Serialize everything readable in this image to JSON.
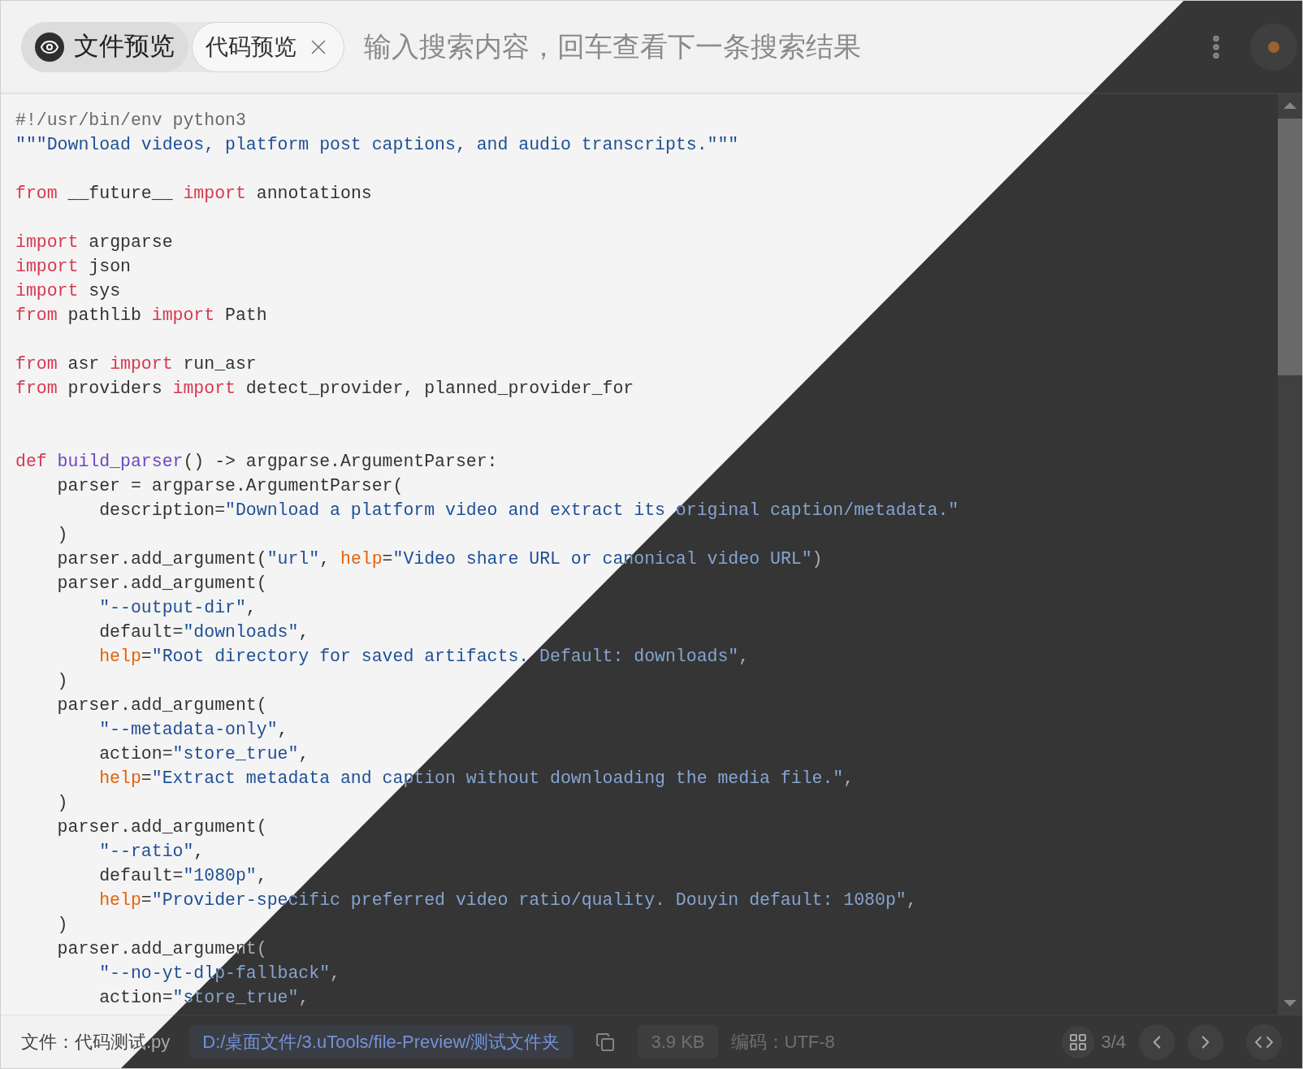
{
  "header": {
    "tabs": [
      {
        "label": "文件预览",
        "selected": false,
        "kind": "mode"
      },
      {
        "label": "代码预览",
        "selected": true,
        "kind": "closable"
      }
    ],
    "search": {
      "placeholder": "输入搜索内容，回车查看下一条搜索结果"
    }
  },
  "code": {
    "lines": [
      {
        "kind": "code",
        "tokens": [
          {
            "kind": "comment",
            "text": "#!/usr/bin/env python3"
          }
        ]
      },
      {
        "kind": "code",
        "tokens": [
          {
            "kind": "string",
            "text": "\"\"\"Download videos, platform post captions, and audio transcripts.\"\"\""
          }
        ]
      },
      {
        "kind": "blank"
      },
      {
        "kind": "code",
        "tokens": [
          {
            "kind": "keyword",
            "text": "from"
          },
          {
            "kind": "plain",
            "text": " __future__ "
          },
          {
            "kind": "keyword",
            "text": "import"
          },
          {
            "kind": "plain",
            "text": " annotations"
          }
        ]
      },
      {
        "kind": "blank"
      },
      {
        "kind": "code",
        "tokens": [
          {
            "kind": "keyword",
            "text": "import"
          },
          {
            "kind": "plain",
            "text": " argparse"
          }
        ]
      },
      {
        "kind": "code",
        "tokens": [
          {
            "kind": "keyword",
            "text": "import"
          },
          {
            "kind": "plain",
            "text": " json"
          }
        ]
      },
      {
        "kind": "code",
        "tokens": [
          {
            "kind": "keyword",
            "text": "import"
          },
          {
            "kind": "plain",
            "text": " sys"
          }
        ]
      },
      {
        "kind": "code",
        "tokens": [
          {
            "kind": "keyword",
            "text": "from"
          },
          {
            "kind": "plain",
            "text": " pathlib "
          },
          {
            "kind": "keyword",
            "text": "import"
          },
          {
            "kind": "plain",
            "text": " Path"
          }
        ]
      },
      {
        "kind": "blank"
      },
      {
        "kind": "code",
        "tokens": [
          {
            "kind": "keyword",
            "text": "from"
          },
          {
            "kind": "plain",
            "text": " asr "
          },
          {
            "kind": "keyword",
            "text": "import"
          },
          {
            "kind": "plain",
            "text": " run_asr"
          }
        ]
      },
      {
        "kind": "code",
        "tokens": [
          {
            "kind": "keyword",
            "text": "from"
          },
          {
            "kind": "plain",
            "text": " providers "
          },
          {
            "kind": "keyword",
            "text": "import"
          },
          {
            "kind": "plain",
            "text": " detect_provider, planned_provider_for"
          }
        ]
      },
      {
        "kind": "blank"
      },
      {
        "kind": "blank"
      },
      {
        "kind": "code",
        "tokens": [
          {
            "kind": "keyword",
            "text": "def "
          },
          {
            "kind": "function",
            "text": "build_parser"
          },
          {
            "kind": "plain",
            "text": "() -> argparse.ArgumentParser:"
          }
        ]
      },
      {
        "kind": "code",
        "tokens": [
          {
            "kind": "plain",
            "text": "    parser = argparse.ArgumentParser("
          }
        ]
      },
      {
        "kind": "code",
        "tokens": [
          {
            "kind": "plain",
            "text": "        description="
          },
          {
            "kind": "string",
            "text": "\"Download a platform video and extract its original caption/metadata.\""
          }
        ]
      },
      {
        "kind": "code",
        "tokens": [
          {
            "kind": "plain",
            "text": "    )"
          }
        ]
      },
      {
        "kind": "code",
        "tokens": [
          {
            "kind": "plain",
            "text": "    parser.add_argument("
          },
          {
            "kind": "string",
            "text": "\"url\""
          },
          {
            "kind": "plain",
            "text": ", "
          },
          {
            "kind": "kwarg",
            "text": "help"
          },
          {
            "kind": "plain",
            "text": "="
          },
          {
            "kind": "string",
            "text": "\"Video share URL or canonical video URL\""
          },
          {
            "kind": "plain",
            "text": ")"
          }
        ]
      },
      {
        "kind": "code",
        "tokens": [
          {
            "kind": "plain",
            "text": "    parser.add_argument("
          }
        ]
      },
      {
        "kind": "code",
        "tokens": [
          {
            "kind": "string",
            "text": "        \"--output-dir\""
          },
          {
            "kind": "plain",
            "text": ","
          }
        ]
      },
      {
        "kind": "code",
        "tokens": [
          {
            "kind": "plain",
            "text": "        default="
          },
          {
            "kind": "string",
            "text": "\"downloads\""
          },
          {
            "kind": "plain",
            "text": ","
          }
        ]
      },
      {
        "kind": "code",
        "tokens": [
          {
            "kind": "kwarg",
            "text": "        help"
          },
          {
            "kind": "plain",
            "text": "="
          },
          {
            "kind": "string",
            "text": "\"Root directory for saved artifacts. Default: downloads\""
          },
          {
            "kind": "plain",
            "text": ","
          }
        ]
      },
      {
        "kind": "code",
        "tokens": [
          {
            "kind": "plain",
            "text": "    )"
          }
        ]
      },
      {
        "kind": "code",
        "tokens": [
          {
            "kind": "plain",
            "text": "    parser.add_argument("
          }
        ]
      },
      {
        "kind": "code",
        "tokens": [
          {
            "kind": "string",
            "text": "        \"--metadata-only\""
          },
          {
            "kind": "plain",
            "text": ","
          }
        ]
      },
      {
        "kind": "code",
        "tokens": [
          {
            "kind": "plain",
            "text": "        action="
          },
          {
            "kind": "string",
            "text": "\"store_true\""
          },
          {
            "kind": "plain",
            "text": ","
          }
        ]
      },
      {
        "kind": "code",
        "tokens": [
          {
            "kind": "kwarg",
            "text": "        help"
          },
          {
            "kind": "plain",
            "text": "="
          },
          {
            "kind": "string",
            "text": "\"Extract metadata and caption without downloading the media file.\""
          },
          {
            "kind": "plain",
            "text": ","
          }
        ]
      },
      {
        "kind": "code",
        "tokens": [
          {
            "kind": "plain",
            "text": "    )"
          }
        ]
      },
      {
        "kind": "code",
        "tokens": [
          {
            "kind": "plain",
            "text": "    parser.add_argument("
          }
        ]
      },
      {
        "kind": "code",
        "tokens": [
          {
            "kind": "string",
            "text": "        \"--ratio\""
          },
          {
            "kind": "plain",
            "text": ","
          }
        ]
      },
      {
        "kind": "code",
        "tokens": [
          {
            "kind": "plain",
            "text": "        default="
          },
          {
            "kind": "string",
            "text": "\"1080p\""
          },
          {
            "kind": "plain",
            "text": ","
          }
        ]
      },
      {
        "kind": "code",
        "tokens": [
          {
            "kind": "kwarg",
            "text": "        help"
          },
          {
            "kind": "plain",
            "text": "="
          },
          {
            "kind": "string",
            "text": "\"Provider-specific preferred video ratio/quality. Douyin default: 1080p\""
          },
          {
            "kind": "plain",
            "text": ","
          }
        ]
      },
      {
        "kind": "code",
        "tokens": [
          {
            "kind": "plain",
            "text": "    )"
          }
        ]
      },
      {
        "kind": "code",
        "tokens": [
          {
            "kind": "plain",
            "text": "    parser.add_argument("
          }
        ]
      },
      {
        "kind": "code",
        "tokens": [
          {
            "kind": "string",
            "text": "        \"--no-yt-dlp-fallback\""
          },
          {
            "kind": "plain",
            "text": ","
          }
        ]
      },
      {
        "kind": "code",
        "tokens": [
          {
            "kind": "plain",
            "text": "        action="
          },
          {
            "kind": "string",
            "text": "\"store_true\""
          },
          {
            "kind": "plain",
            "text": ","
          }
        ]
      }
    ]
  },
  "status_bar": {
    "file_label": "文件：代码测试.py",
    "path": "D:/桌面文件/3.uTools/file-Preview/测试文件夹",
    "size": "3.9 KB",
    "encoding": "编码：UTF-8",
    "page": "3/4"
  }
}
